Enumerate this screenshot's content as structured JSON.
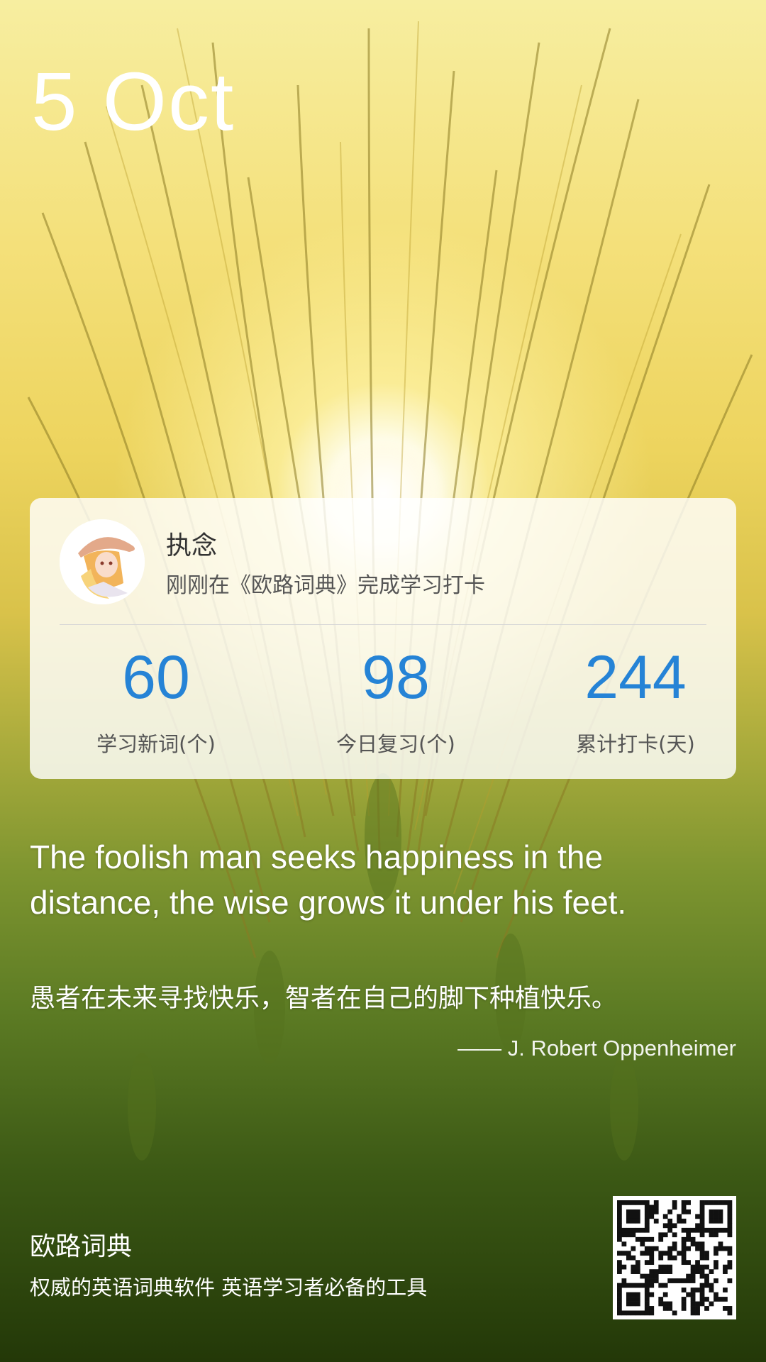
{
  "date": {
    "text": "5 Oct"
  },
  "card": {
    "username": "执念",
    "checkin_message": "刚刚在《欧路词典》完成学习打卡",
    "stats": [
      {
        "value": "60",
        "label": "学习新词(个)"
      },
      {
        "value": "98",
        "label": "今日复习(个)"
      },
      {
        "value": "244",
        "label": "累计打卡(天)"
      }
    ]
  },
  "quote": {
    "english": "The foolish man seeks happiness in the distance, the wise grows it under his feet.",
    "chinese": "愚者在未来寻找快乐，智者在自己的脚下种植快乐。",
    "author": "—— J. Robert Oppenheimer"
  },
  "footer": {
    "brand": "欧路词典",
    "slogan": "权威的英语词典软件 英语学习者必备的工具"
  },
  "colors": {
    "stat_value": "#2583d6",
    "card_background": "#ffffff"
  },
  "icons": {
    "avatar": "user-avatar-anime",
    "qr": "qr-code"
  }
}
